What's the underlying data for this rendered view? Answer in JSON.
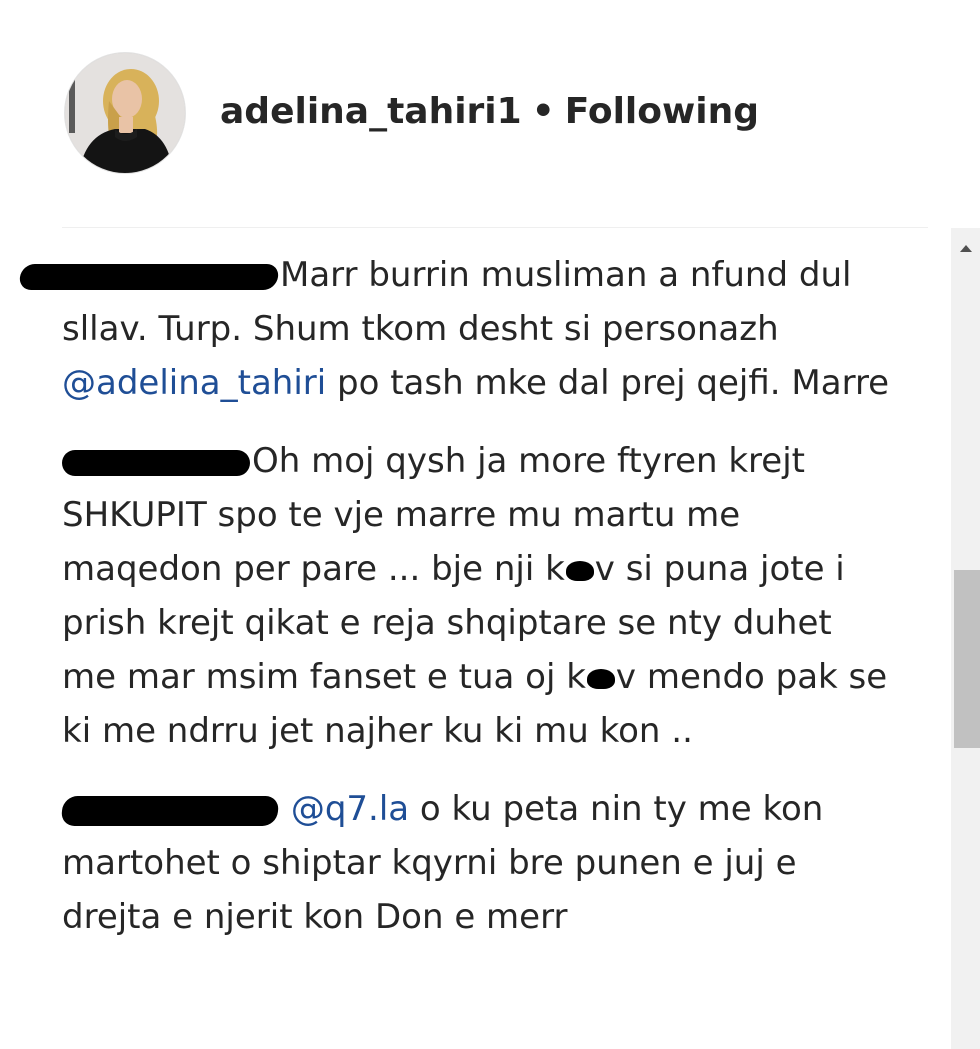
{
  "header": {
    "username": "adelina_tahiri1",
    "separator": "•",
    "follow_status": "Following",
    "avatar_icon": "profile-photo"
  },
  "comments": [
    {
      "text_before_mention": "Marr burrin musliman a nfund dul sllav. Turp. Shum tkom desht si personazh ",
      "mention": "@adelina_tahiri",
      "text_after_mention": " po tash mke dal prej qejfi. Marre"
    },
    {
      "part1": "Oh moj qysh ja more ftyren krejt SHKUPIT spo te vje marre mu martu me maqedon per pare ... bje nji k",
      "part2": "v si puna jote i prish krejt qikat e reja shqiptare se nty duhet me mar msim fanset e tua oj k",
      "part3": "v mendo pak se ki me ndrru jet najher ku ki mu kon .."
    },
    {
      "mention": "@q7.la",
      "text_after_mention": " o ku peta nin ty me kon martohet o shiptar kqyrni bre punen e juj e drejta e njerit kon Don e merr"
    }
  ],
  "colors": {
    "mention": "#1f4e96",
    "text": "#262626",
    "scroll_track": "#f1f1f1",
    "scroll_thumb": "#c1c1c1"
  },
  "scrollbar": {
    "up_arrow_icon": "chevron-up-icon"
  }
}
